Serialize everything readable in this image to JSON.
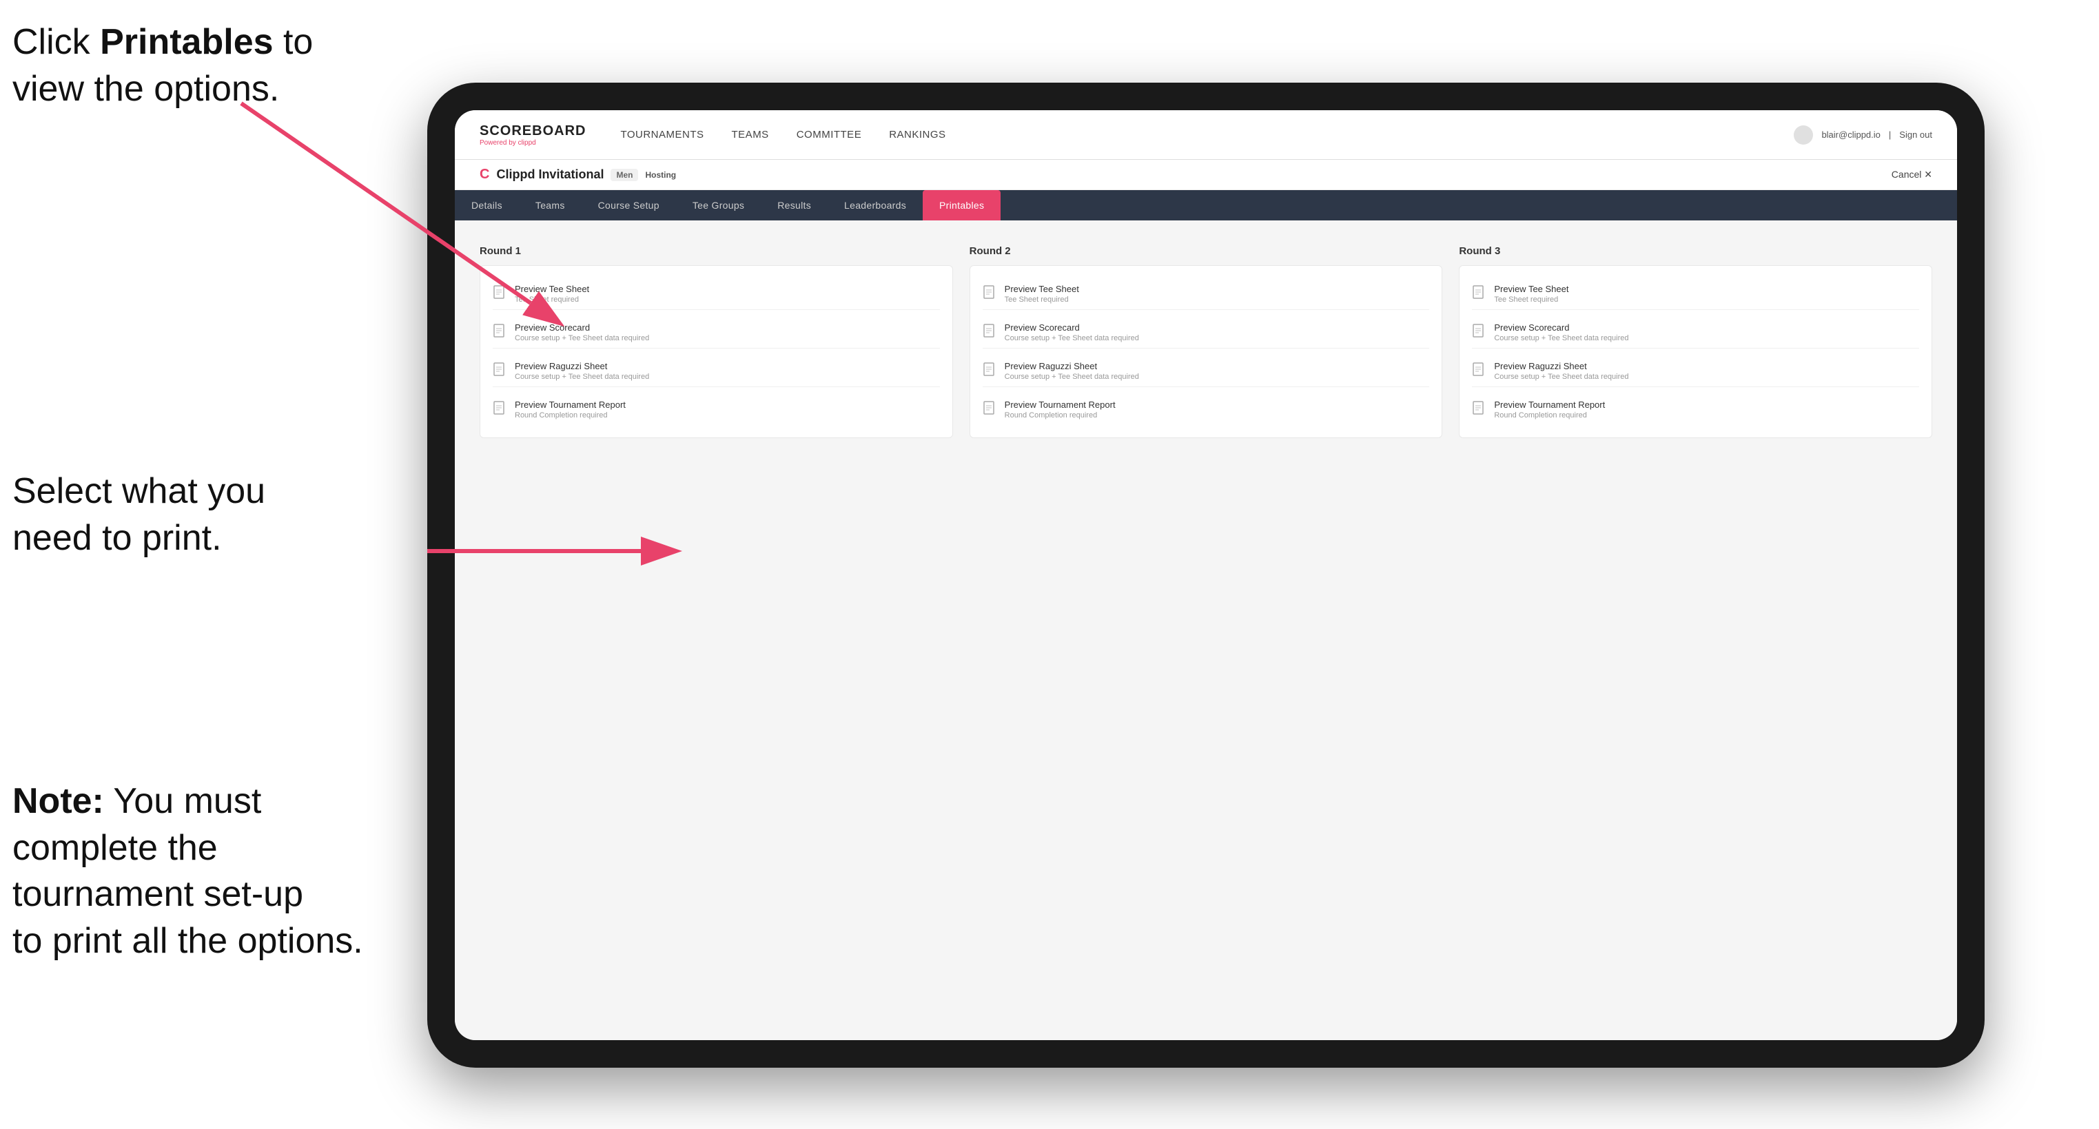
{
  "instructions": {
    "top": {
      "prefix": "Click ",
      "bold": "Printables",
      "suffix": " to\nview the options."
    },
    "mid": "Select what you\nneed to print.",
    "bottom": {
      "bold": "Note:",
      "text": " You must\ncomplete the\ntournament set-up\nto print all the options."
    }
  },
  "nav": {
    "logo_title": "SCOREBOARD",
    "logo_sub": "Powered by clippd",
    "links": [
      {
        "label": "TOURNAMENTS",
        "active": false
      },
      {
        "label": "TEAMS",
        "active": false
      },
      {
        "label": "COMMITTEE",
        "active": false
      },
      {
        "label": "RANKINGS",
        "active": false
      }
    ],
    "user_email": "blair@clippd.io",
    "sign_out": "Sign out"
  },
  "tournament": {
    "logo": "C",
    "name": "Clippd Invitational",
    "badge": "Men",
    "status": "Hosting",
    "cancel": "Cancel ✕"
  },
  "sub_tabs": [
    {
      "label": "Details",
      "active": false
    },
    {
      "label": "Teams",
      "active": false
    },
    {
      "label": "Course Setup",
      "active": false
    },
    {
      "label": "Tee Groups",
      "active": false
    },
    {
      "label": "Results",
      "active": false
    },
    {
      "label": "Leaderboards",
      "active": false
    },
    {
      "label": "Printables",
      "active": true
    }
  ],
  "rounds": [
    {
      "title": "Round 1",
      "items": [
        {
          "label": "Preview Tee Sheet",
          "sublabel": "Tee Sheet required"
        },
        {
          "label": "Preview Scorecard",
          "sublabel": "Course setup + Tee Sheet data required"
        },
        {
          "label": "Preview Raguzzi Sheet",
          "sublabel": "Course setup + Tee Sheet data required"
        },
        {
          "label": "Preview Tournament Report",
          "sublabel": "Round Completion required"
        }
      ]
    },
    {
      "title": "Round 2",
      "items": [
        {
          "label": "Preview Tee Sheet",
          "sublabel": "Tee Sheet required"
        },
        {
          "label": "Preview Scorecard",
          "sublabel": "Course setup + Tee Sheet data required"
        },
        {
          "label": "Preview Raguzzi Sheet",
          "sublabel": "Course setup + Tee Sheet data required"
        },
        {
          "label": "Preview Tournament Report",
          "sublabel": "Round Completion required"
        }
      ]
    },
    {
      "title": "Round 3",
      "items": [
        {
          "label": "Preview Tee Sheet",
          "sublabel": "Tee Sheet required"
        },
        {
          "label": "Preview Scorecard",
          "sublabel": "Course setup + Tee Sheet data required"
        },
        {
          "label": "Preview Raguzzi Sheet",
          "sublabel": "Course setup + Tee Sheet data required"
        },
        {
          "label": "Preview Tournament Report",
          "sublabel": "Round Completion required"
        }
      ]
    }
  ],
  "colors": {
    "accent": "#e8426a",
    "nav_bg": "#2d3748"
  }
}
